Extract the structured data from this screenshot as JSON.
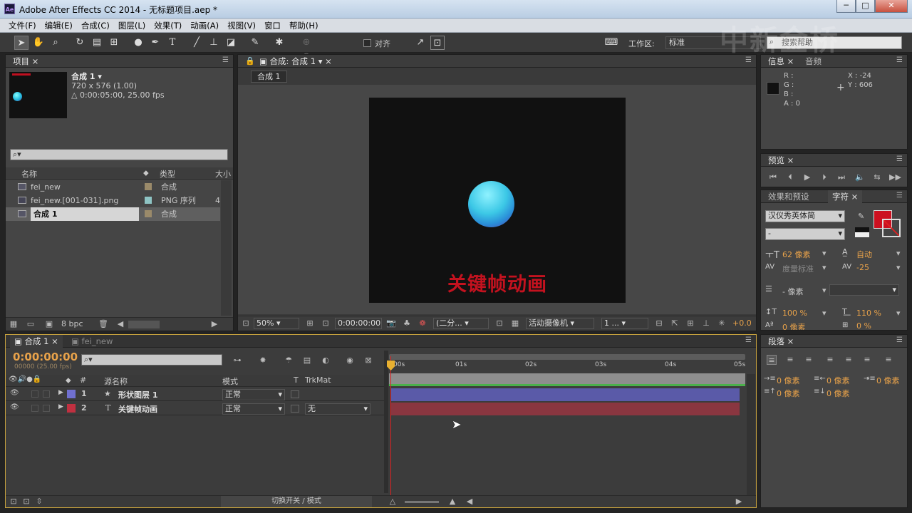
{
  "window": {
    "title": "Adobe After Effects CC 2014 - 无标题项目.aep *",
    "icon": "Ae"
  },
  "watermark": "中新金桥",
  "menu": [
    "文件(F)",
    "编辑(E)",
    "合成(C)",
    "图层(L)",
    "效果(T)",
    "动画(A)",
    "视图(V)",
    "窗口",
    "帮助(H)"
  ],
  "toolbar": {
    "snap_label": "对齐",
    "workspace_label": "工作区:",
    "workspace_value": "标准",
    "search_placeholder": "搜索帮助"
  },
  "project": {
    "tab": "项目",
    "comp_name": "合成 1 ▾",
    "comp_size": "720 x 576 (1.00)",
    "comp_duration": "△ 0:00:05:00, 25.00 fps",
    "search_placeholder": "⌕▾",
    "columns": {
      "name": "名称",
      "type": "类型",
      "size": "大小"
    },
    "items": [
      {
        "name": "fei_new",
        "type": "合成",
        "size": "",
        "color": "#9a8a6a"
      },
      {
        "name": "fei_new.[001-031].png",
        "type": "PNG 序列",
        "size": "4",
        "color": "#8ec4c4"
      },
      {
        "name": "合成 1",
        "type": "合成",
        "size": "",
        "color": "#9a8a6a"
      }
    ],
    "bpc": "8 bpc"
  },
  "composition": {
    "tab": "合成: 合成 1",
    "breadcrumb": "合成 1",
    "canvas_text": "关键帧动画",
    "zoom": "50%",
    "timecode": "0:00:00:00",
    "resolution": "(二分...",
    "camera": "活动摄像机",
    "views": "1 ...",
    "exposure": "+0.0"
  },
  "info": {
    "tabs": [
      "信息",
      "音频"
    ],
    "r": "R :",
    "g": "G :",
    "b": "B :",
    "a": "A : 0",
    "x": "X : -24",
    "y": "Y : 606"
  },
  "preview": {
    "tab": "预览"
  },
  "character": {
    "tabs": [
      "效果和预设",
      "字符"
    ],
    "font": "汉仪秀英体简",
    "style": "-",
    "size": "62 像素",
    "leading": "自动",
    "kerning": "度量标准",
    "tracking": "-25",
    "stroke": "- 像素",
    "vscale": "100 %",
    "hscale": "110 %",
    "baseline": "0 像素",
    "tsume": "0 %",
    "fill_color": "#cc1020"
  },
  "paragraph": {
    "tab": "段落",
    "indent_left": "0 像素",
    "indent_right": "0 像素",
    "indent_first": "0 像素",
    "space_before": "0 像素",
    "space_after": "0 像素"
  },
  "timeline": {
    "tabs": [
      "合成 1",
      "fei_new"
    ],
    "timecode": "0:00:00:00",
    "frames": "00000 (25.00 fps)",
    "search_placeholder": "⌕▾",
    "columns": {
      "hash": "#",
      "source": "源名称",
      "mode": "模式",
      "t": "T",
      "trkmat": "TrkMat"
    },
    "ruler": [
      "00s",
      "01s",
      "02s",
      "03s",
      "04s",
      "05s"
    ],
    "layers": [
      {
        "num": "1",
        "name": "形状图层 1",
        "mode": "正常",
        "trkmat": "",
        "label_color": "#7070d0",
        "bar_color": "#5a5aa8"
      },
      {
        "num": "2",
        "name": "关键帧动画",
        "mode": "正常",
        "trkmat": "无",
        "label_color": "#c03040",
        "bar_color": "#8a3640"
      }
    ],
    "toggle_label": "切换开关 / 模式"
  }
}
